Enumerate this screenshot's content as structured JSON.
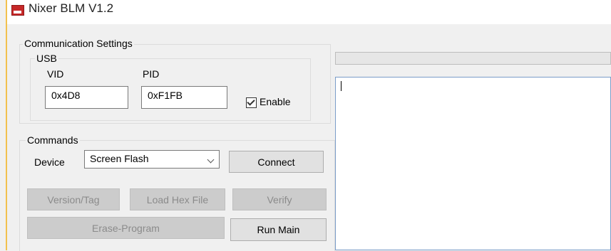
{
  "window": {
    "title": "Nixer BLM V1.2"
  },
  "communication": {
    "title": "Communication Settings",
    "usb": {
      "title": "USB",
      "vid_label": "VID",
      "pid_label": "PID",
      "vid_value": "0x4D8",
      "pid_value": "0xF1FB",
      "enable_label": "Enable",
      "enable_checked": true
    }
  },
  "commands": {
    "title": "Commands",
    "device_label": "Device",
    "device_selected": "Screen Flash",
    "connect_label": "Connect",
    "version_label": "Version/Tag",
    "load_hex_label": "Load Hex File",
    "verify_label": "Verify",
    "erase_program_label": "Erase-Program",
    "run_main_label": "Run Main"
  },
  "output": {
    "text": ""
  }
}
